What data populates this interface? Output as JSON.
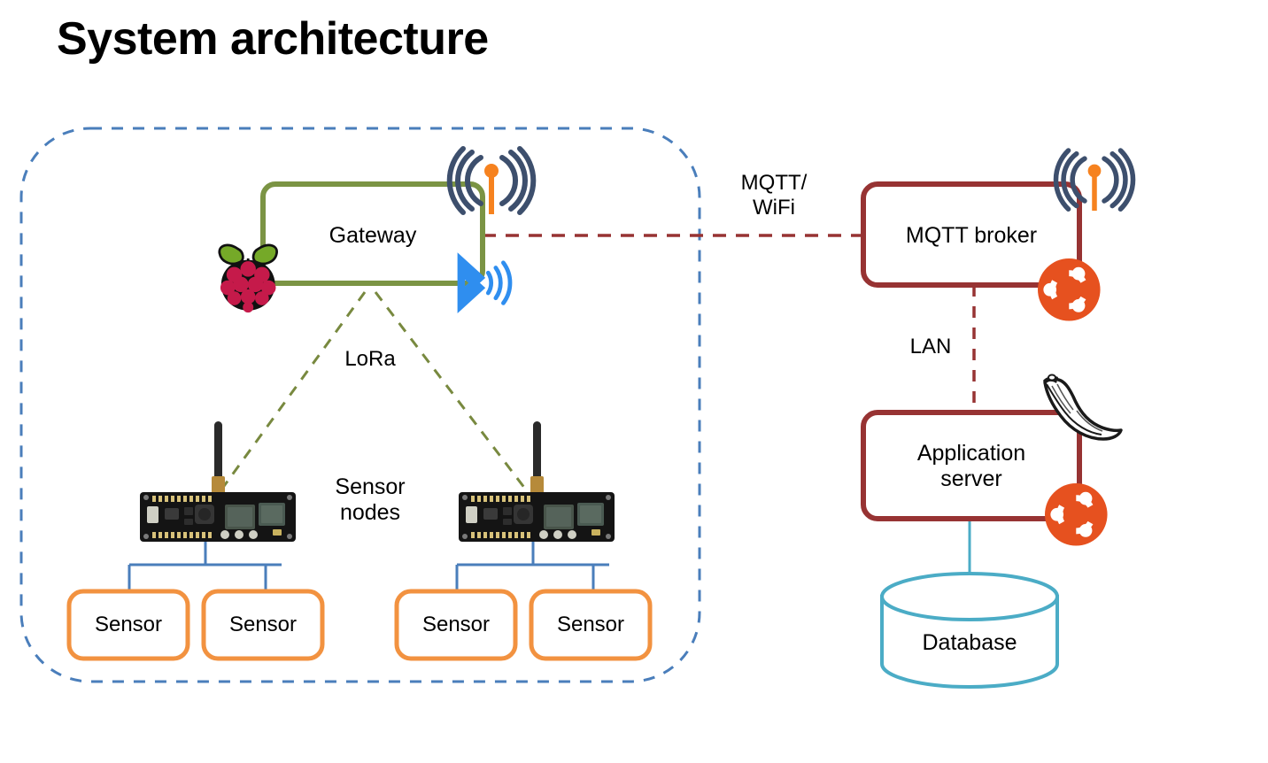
{
  "title": "System architecture",
  "colors": {
    "boundary_dashed": "#4a7ebb",
    "gateway_border": "#7b9444",
    "broker_border": "#973333",
    "lora_dashed": "#78893f",
    "mqtt_dashed": "#973333",
    "lan_dashed": "#973333",
    "sensor_border": "#f29240",
    "sensor_link": "#4a7ebb",
    "database_border": "#4bacc6",
    "db_link": "#4bacc6",
    "wifi_arc": "#3d4f6d",
    "wifi_mast": "#f6821f",
    "bluetooth": "#2f8eef",
    "ubuntu": "#e6511f",
    "raspberry_berry": "#c51a4a",
    "raspberry_leaf": "#75a928",
    "pcb": "#1b1b1b",
    "text": "#000000"
  },
  "boundary": {
    "name": "local-sensor-network-boundary",
    "style": "dashed-rounded-rectangle"
  },
  "nodes": {
    "gateway": {
      "label": "Gateway",
      "border_color": "#7b9444",
      "icons": [
        "raspberry-pi-icon",
        "wifi-antenna-icon",
        "bluetooth-icon"
      ]
    },
    "sensor_nodes_label": "Sensor\nnodes",
    "sensor_node_left": {
      "label": "",
      "icon": "lora-board-icon"
    },
    "sensor_node_right": {
      "label": "",
      "icon": "lora-board-icon"
    },
    "sensors": [
      {
        "label": "Sensor",
        "group": "left"
      },
      {
        "label": "Sensor",
        "group": "left"
      },
      {
        "label": "Sensor",
        "group": "right"
      },
      {
        "label": "Sensor",
        "group": "right"
      }
    ],
    "mqtt_broker": {
      "label": "MQTT broker",
      "border_color": "#973333",
      "icons": [
        "wifi-antenna-icon",
        "ubuntu-icon"
      ]
    },
    "application_server": {
      "label": "Application\nserver",
      "border_color": "#973333",
      "icons": [
        "flask-icon",
        "ubuntu-icon"
      ]
    },
    "database": {
      "label": "Database",
      "border_color": "#4bacc6",
      "shape": "cylinder"
    }
  },
  "edges": {
    "gateway_to_broker": {
      "label": "MQTT/\nWiFi",
      "style": "dashed",
      "color": "#973333"
    },
    "gateway_to_sensor_nodes": {
      "label": "LoRa",
      "style": "dashed",
      "color": "#78893f"
    },
    "broker_to_appserver": {
      "label": "LAN",
      "style": "dashed",
      "color": "#973333"
    },
    "appserver_to_database": {
      "label": "",
      "style": "solid",
      "color": "#4bacc6"
    },
    "node_to_sensors": {
      "label": "",
      "style": "solid",
      "color": "#4a7ebb"
    }
  }
}
